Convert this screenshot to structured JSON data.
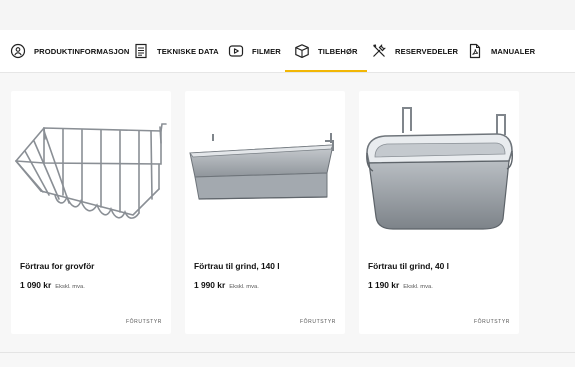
{
  "tabs": [
    {
      "label": "PRODUKTINFORMASJON",
      "icon": "info-person-icon"
    },
    {
      "label": "TEKNISKE DATA",
      "icon": "document-icon"
    },
    {
      "label": "FILMER",
      "icon": "play-icon"
    },
    {
      "label": "TILBEHØR",
      "icon": "box-icon",
      "active": true
    },
    {
      "label": "RESERVEDELER",
      "icon": "tools-icon"
    },
    {
      "label": "MANUALER",
      "icon": "pdf-icon"
    }
  ],
  "accent_color": "#f2b705",
  "products": [
    {
      "title": "Förtrau for grovför",
      "price": "1 090 kr",
      "vat_note": "Ekskl. mva.",
      "tag": "FÔRUTSTYR",
      "image": "wire-hay-basket"
    },
    {
      "title": "Förtrau til grind, 140 l",
      "price": "1 990 kr",
      "vat_note": "Ekskl. mva.",
      "tag": "FÔRUTSTYR",
      "image": "long-galvanized-trough"
    },
    {
      "title": "Förtrau til grind, 40 l",
      "price": "1 190 kr",
      "vat_note": "Ekskl. mva.",
      "tag": "FÔRUTSTYR",
      "image": "galvanized-bucket-trough"
    }
  ]
}
